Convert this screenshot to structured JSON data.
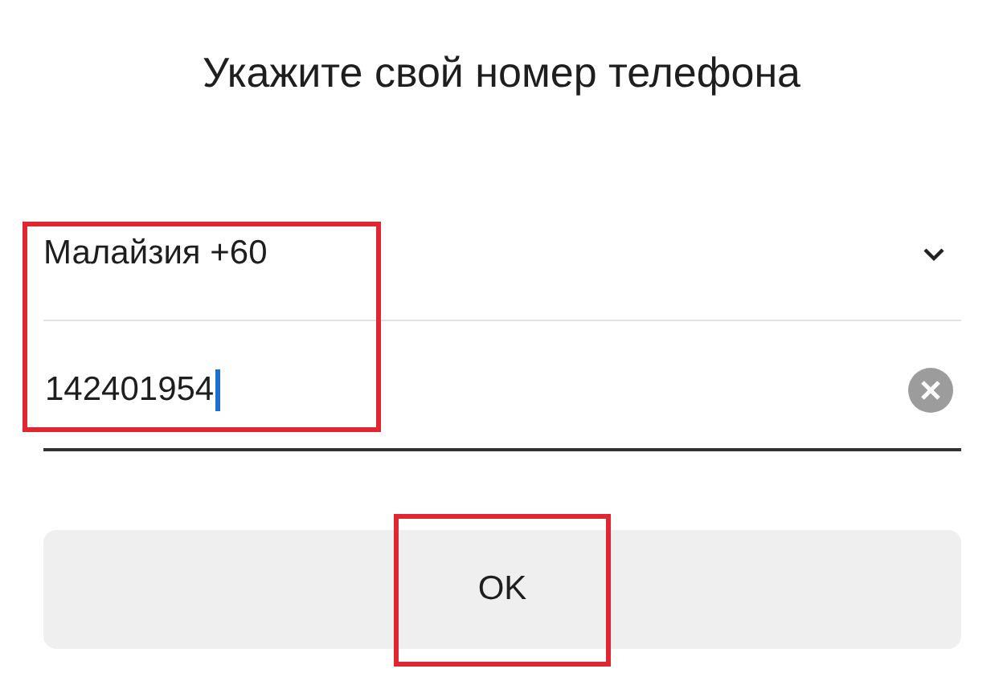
{
  "title": "Укажите свой номер телефона",
  "country_select": {
    "value": "Малайзия +60"
  },
  "phone_field": {
    "value": "142401954",
    "focused": true
  },
  "fields_highlighted": true,
  "ok_button": {
    "label": "OK",
    "highlighted": true
  }
}
